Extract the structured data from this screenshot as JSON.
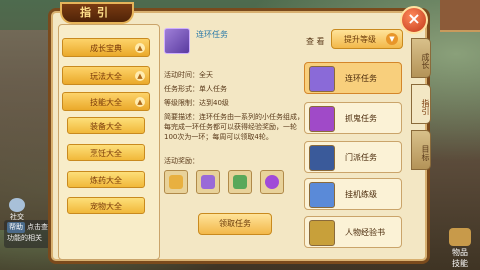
{
  "panel": {
    "title": "指引",
    "close_label": "×"
  },
  "left_nav": [
    {
      "label": "成长宝典",
      "kind": "cat",
      "arrow": "▲"
    },
    {
      "label": "玩法大全",
      "kind": "cat",
      "arrow": "▲"
    },
    {
      "label": "技能大全",
      "kind": "cat",
      "arrow": "▲"
    },
    {
      "label": "装备大全",
      "kind": "sub"
    },
    {
      "label": "烹饪大全",
      "kind": "sub"
    },
    {
      "label": "炼药大全",
      "kind": "sub"
    },
    {
      "label": "宠物大全",
      "kind": "sub"
    }
  ],
  "content": {
    "task_name": "连环任务",
    "view_label": "查 看",
    "level_button": "提升等级",
    "level_chevron": "▼",
    "time": "活动时间：全天",
    "form": "任务形式：单人任务",
    "level_req": "等级限制：达到40级",
    "desc": "简要描述：连环任务由一系列的小任务组成，每完成一环任务都可以获得经验奖励，一轮100次为一环；每周可以领取4轮。",
    "rewards_label": "活动奖励：",
    "accept_button": "领取任务"
  },
  "task_list": [
    {
      "label": "连环任务",
      "active": true,
      "color": "#8a6ad8"
    },
    {
      "label": "抓鬼任务",
      "active": false,
      "color": "#a04ac8"
    },
    {
      "label": "门派任务",
      "active": false,
      "color": "#3a5a9a"
    },
    {
      "label": "挂机练级",
      "active": false,
      "color": "#5a8ad8"
    },
    {
      "label": "人物经验书",
      "active": false,
      "color": "#c8a03a"
    }
  ],
  "side_tabs": [
    {
      "label": "成长",
      "active": false
    },
    {
      "label": "指引",
      "active": true
    },
    {
      "label": "目标",
      "active": false
    }
  ],
  "bg": {
    "chat_tag": "帮助",
    "chat_text": "点击查看",
    "chat_text2": "功能的相关",
    "social_label": "社交",
    "bottom_right_label": "物品",
    "bottom_right_label2": "技能"
  },
  "colors": {
    "panel_bg": "#f3e7c4",
    "panel_border": "#7a4a1c",
    "button_gold": "#f2b84a",
    "accent_text": "#2a7aa8"
  }
}
